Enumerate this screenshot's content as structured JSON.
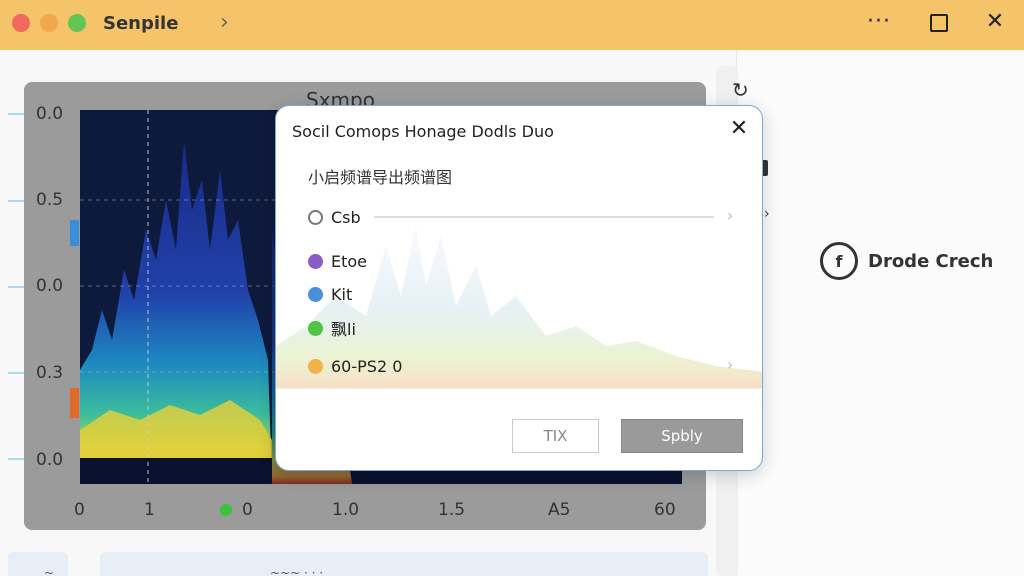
{
  "window": {
    "title": "Senpile",
    "more_icon": "more-icon",
    "accent": "#f5c46a"
  },
  "chart": {
    "title": "Sxmpo",
    "y_ticks": [
      "0.0",
      "0.5",
      "0.0",
      "0.3",
      "0.0"
    ],
    "x_ticks": [
      "0",
      "1",
      "0",
      "1.0",
      "1.5",
      "A5",
      "60"
    ]
  },
  "side_action": {
    "label": "Drode Crech",
    "icon": "f"
  },
  "dialog": {
    "title": "Socil Comops Honage  Dodls Duo",
    "subtitle": "小启频谱导出频谱图",
    "options": [
      {
        "label": "Csb",
        "color": "#ffffff"
      },
      {
        "label": "Etoe",
        "color": "#8a5cc6"
      },
      {
        "label": "Kit",
        "color": "#4a90d9"
      },
      {
        "label": "飘li",
        "color": "#4fc445"
      },
      {
        "label": "60-PS2 0",
        "color": "#f0b24a"
      }
    ],
    "cancel_label": "TIX",
    "apply_label": "Spbly"
  },
  "bottom": {
    "left_text": "~",
    "center_text": "~~~ · · ·"
  }
}
